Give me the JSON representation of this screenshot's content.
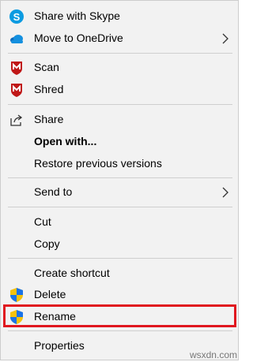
{
  "menu": {
    "items": [
      {
        "label": "Share with Skype",
        "icon": "skype-icon"
      },
      {
        "label": "Move to OneDrive",
        "icon": "onedrive-icon",
        "submenu": true
      },
      {
        "label": "Scan",
        "icon": "mcafee-icon"
      },
      {
        "label": "Shred",
        "icon": "mcafee-icon"
      },
      {
        "label": "Share",
        "icon": "share-icon"
      },
      {
        "label": "Open with...",
        "bold": true
      },
      {
        "label": "Restore previous versions"
      },
      {
        "label": "Send to",
        "submenu": true
      },
      {
        "label": "Cut"
      },
      {
        "label": "Copy"
      },
      {
        "label": "Create shortcut"
      },
      {
        "label": "Delete",
        "icon": "uac-shield-icon"
      },
      {
        "label": "Rename",
        "icon": "uac-shield-icon",
        "highlighted": true
      },
      {
        "label": "Properties"
      }
    ]
  },
  "colors": {
    "highlight_border": "#e0171f",
    "skype_blue": "#0c9be1",
    "onedrive_blue": "#0f6cbd",
    "mcafee_red": "#c01818"
  },
  "watermark": "wsxdn.com"
}
